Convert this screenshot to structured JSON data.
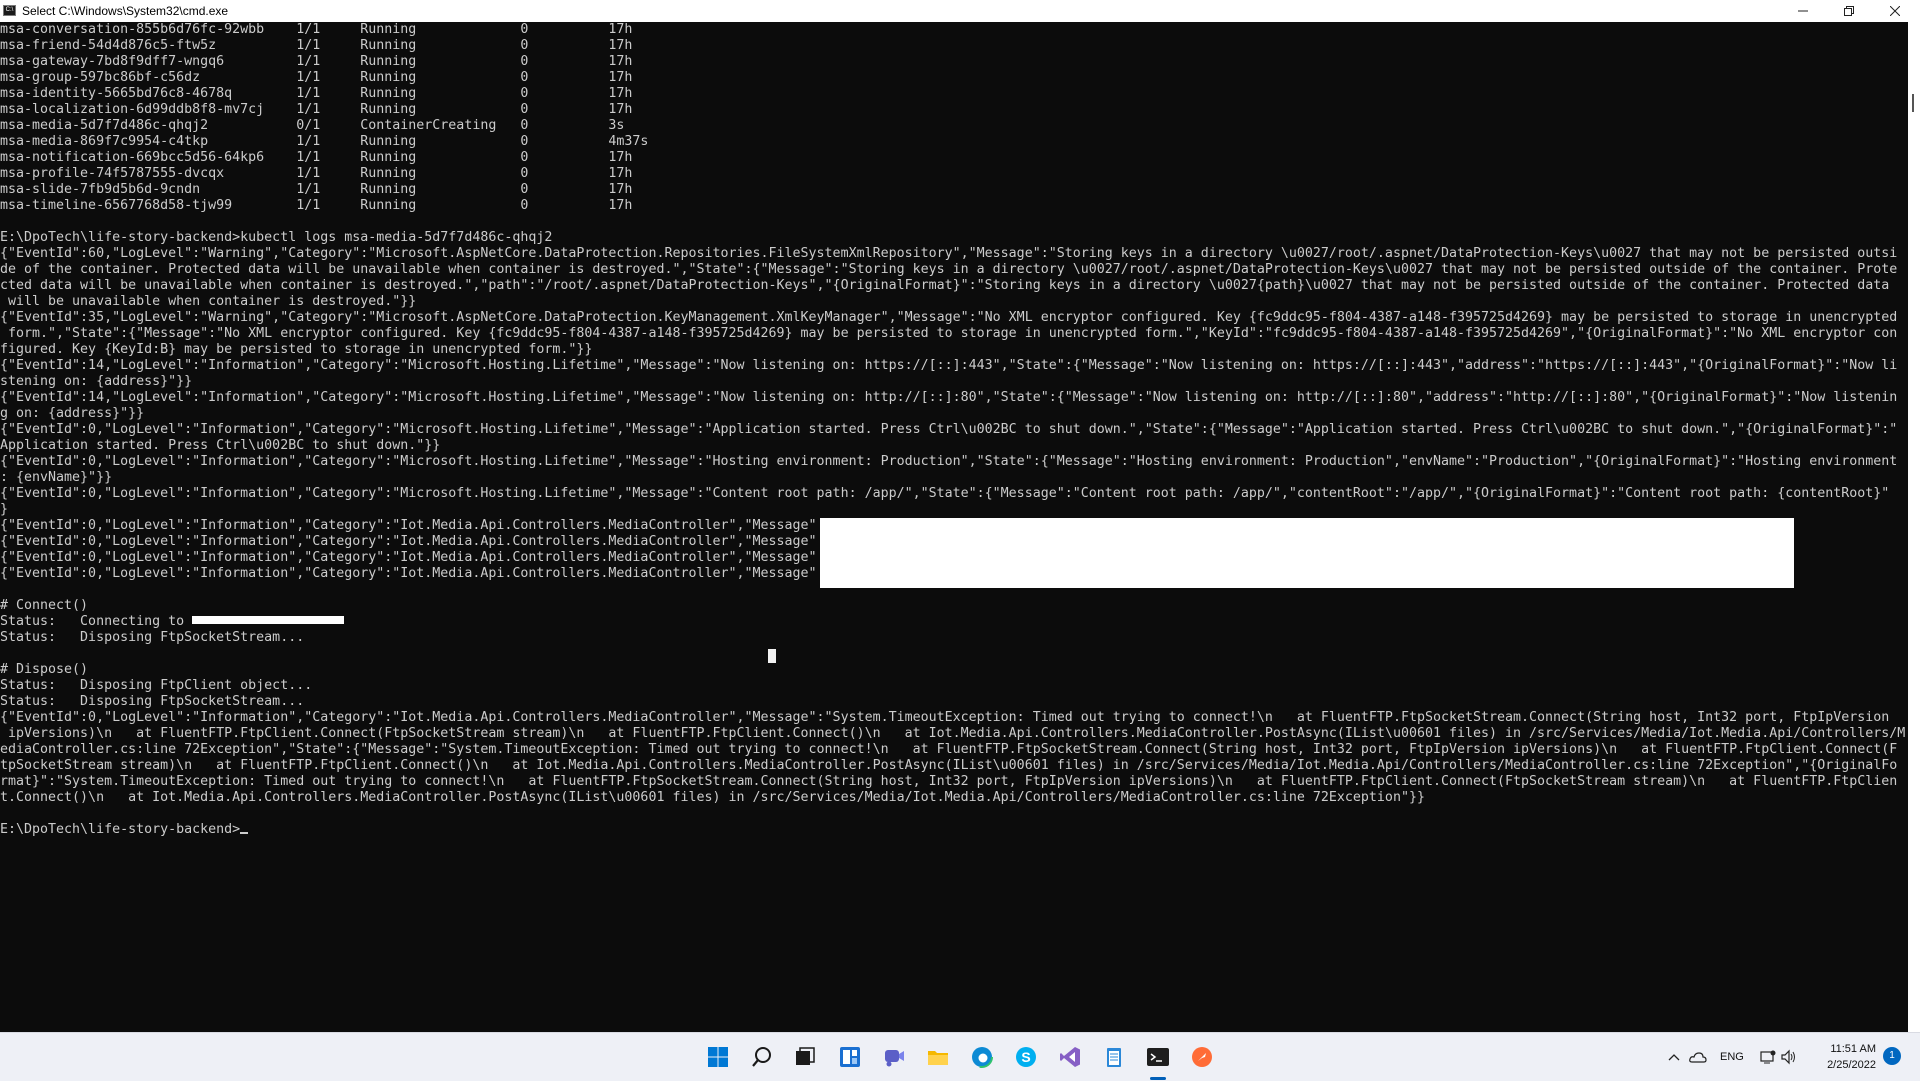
{
  "window": {
    "title": "Select C:\\Windows\\System32\\cmd.exe",
    "icon_label": "C:\\"
  },
  "console": {
    "lines": [
      "msa-conversation-855b6d76fc-92wbb    1/1     Running             0          17h",
      "msa-friend-54d4d876c5-ftw5z          1/1     Running             0          17h",
      "msa-gateway-7bd8f9dff7-wngq6         1/1     Running             0          17h",
      "msa-group-597bc86bf-c56dz            1/1     Running             0          17h",
      "msa-identity-5665bd76c8-4678q        1/1     Running             0          17h",
      "msa-localization-6d99ddb8f8-mv7cj    1/1     Running             0          17h",
      "msa-media-5d7f7d486c-qhqj2           0/1     ContainerCreating   0          3s",
      "msa-media-869f7c9954-c4tkp           1/1     Running             0          4m37s",
      "msa-notification-669bcc5d56-64kp6    1/1     Running             0          17h",
      "msa-profile-74f5787555-dvcqx         1/1     Running             0          17h",
      "msa-slide-7fb9d5b6d-9cndn            1/1     Running             0          17h",
      "msa-timeline-6567768d58-tjw99        1/1     Running             0          17h",
      "",
      "E:\\DpoTech\\life-story-backend>kubectl logs msa-media-5d7f7d486c-qhqj2",
      "{\"EventId\":60,\"LogLevel\":\"Warning\",\"Category\":\"Microsoft.AspNetCore.DataProtection.Repositories.FileSystemXmlRepository\",\"Message\":\"Storing keys in a directory \\u0027/root/.aspnet/DataProtection-Keys\\u0027 that may not be persisted outsi",
      "de of the container. Protected data will be unavailable when container is destroyed.\",\"State\":{\"Message\":\"Storing keys in a directory \\u0027/root/.aspnet/DataProtection-Keys\\u0027 that may not be persisted outside of the container. Prote",
      "cted data will be unavailable when container is destroyed.\",\"path\":\"/root/.aspnet/DataProtection-Keys\",\"{OriginalFormat}\":\"Storing keys in a directory \\u0027{path}\\u0027 that may not be persisted outside of the container. Protected data",
      " will be unavailable when container is destroyed.\"}}",
      "{\"EventId\":35,\"LogLevel\":\"Warning\",\"Category\":\"Microsoft.AspNetCore.DataProtection.KeyManagement.XmlKeyManager\",\"Message\":\"No XML encryptor configured. Key {fc9ddc95-f804-4387-a148-f395725d4269} may be persisted to storage in unencrypted",
      " form.\",\"State\":{\"Message\":\"No XML encryptor configured. Key {fc9ddc95-f804-4387-a148-f395725d4269} may be persisted to storage in unencrypted form.\",\"KeyId\":\"fc9ddc95-f804-4387-a148-f395725d4269\",\"{OriginalFormat}\":\"No XML encryptor con",
      "figured. Key {KeyId:B} may be persisted to storage in unencrypted form.\"}}",
      "{\"EventId\":14,\"LogLevel\":\"Information\",\"Category\":\"Microsoft.Hosting.Lifetime\",\"Message\":\"Now listening on: https://[::]:443\",\"State\":{\"Message\":\"Now listening on: https://[::]:443\",\"address\":\"https://[::]:443\",\"{OriginalFormat}\":\"Now li",
      "stening on: {address}\"}}",
      "{\"EventId\":14,\"LogLevel\":\"Information\",\"Category\":\"Microsoft.Hosting.Lifetime\",\"Message\":\"Now listening on: http://[::]:80\",\"State\":{\"Message\":\"Now listening on: http://[::]:80\",\"address\":\"http://[::]:80\",\"{OriginalFormat}\":\"Now listenin",
      "g on: {address}\"}}",
      "{\"EventId\":0,\"LogLevel\":\"Information\",\"Category\":\"Microsoft.Hosting.Lifetime\",\"Message\":\"Application started. Press Ctrl\\u002BC to shut down.\",\"State\":{\"Message\":\"Application started. Press Ctrl\\u002BC to shut down.\",\"{OriginalFormat}\":\"",
      "Application started. Press Ctrl\\u002BC to shut down.\"}}",
      "{\"EventId\":0,\"LogLevel\":\"Information\",\"Category\":\"Microsoft.Hosting.Lifetime\",\"Message\":\"Hosting environment: Production\",\"State\":{\"Message\":\"Hosting environment: Production\",\"envName\":\"Production\",\"{OriginalFormat}\":\"Hosting environment",
      ": {envName}\"}}",
      "{\"EventId\":0,\"LogLevel\":\"Information\",\"Category\":\"Microsoft.Hosting.Lifetime\",\"Message\":\"Content root path: /app/\",\"State\":{\"Message\":\"Content root path: /app/\",\"contentRoot\":\"/app/\",\"{OriginalFormat}\":\"Content root path: {contentRoot}\"",
      "}",
      "{\"EventId\":0,\"LogLevel\":\"Information\",\"Category\":\"Iot.Media.Api.Controllers.MediaController\",\"Message\"",
      "{\"EventId\":0,\"LogLevel\":\"Information\",\"Category\":\"Iot.Media.Api.Controllers.MediaController\",\"Message\"",
      "{\"EventId\":0,\"LogLevel\":\"Information\",\"Category\":\"Iot.Media.Api.Controllers.MediaController\",\"Message\"",
      "{\"EventId\":0,\"LogLevel\":\"Information\",\"Category\":\"Iot.Media.Api.Controllers.MediaController\",\"Message\"",
      "",
      "# Connect()",
      "Status:   Connecting to ",
      "Status:   Disposing FtpSocketStream...",
      "",
      "# Dispose()",
      "Status:   Disposing FtpClient object...",
      "Status:   Disposing FtpSocketStream...",
      "{\"EventId\":0,\"LogLevel\":\"Information\",\"Category\":\"Iot.Media.Api.Controllers.MediaController\",\"Message\":\"System.TimeoutException: Timed out trying to connect!\\n   at FluentFTP.FtpSocketStream.Connect(String host, Int32 port, FtpIpVersion",
      " ipVersions)\\n   at FluentFTP.FtpClient.Connect(FtpSocketStream stream)\\n   at FluentFTP.FtpClient.Connect()\\n   at Iot.Media.Api.Controllers.MediaController.PostAsync(IList\\u00601 files) in /src/Services/Media/Iot.Media.Api/Controllers/M",
      "ediaController.cs:line 72Exception\",\"State\":{\"Message\":\"System.TimeoutException: Timed out trying to connect!\\n   at FluentFTP.FtpSocketStream.Connect(String host, Int32 port, FtpIpVersion ipVersions)\\n   at FluentFTP.FtpClient.Connect(F",
      "tpSocketStream stream)\\n   at FluentFTP.FtpClient.Connect()\\n   at Iot.Media.Api.Controllers.MediaController.PostAsync(IList\\u00601 files) in /src/Services/Media/Iot.Media.Api/Controllers/MediaController.cs:line 72Exception\",\"{OriginalFo",
      "rmat}\":\"System.TimeoutException: Timed out trying to connect!\\n   at FluentFTP.FtpSocketStream.Connect(String host, Int32 port, FtpIpVersion ipVersions)\\n   at FluentFTP.FtpClient.Connect(FtpSocketStream stream)\\n   at FluentFTP.FtpClien",
      "t.Connect()\\n   at Iot.Media.Api.Controllers.MediaController.PostAsync(IList\\u00601 files) in /src/Services/Media/Iot.Media.Api/Controllers/MediaController.cs:line 72Exception\"}}",
      "",
      "E:\\DpoTech\\life-story-backend>"
    ]
  },
  "taskbar": {
    "apps": [
      {
        "name": "start-icon"
      },
      {
        "name": "search-icon"
      },
      {
        "name": "task-view-icon"
      },
      {
        "name": "widgets-icon"
      },
      {
        "name": "chat-icon"
      },
      {
        "name": "file-explorer-icon"
      },
      {
        "name": "edge-icon"
      },
      {
        "name": "skype-icon"
      },
      {
        "name": "visual-studio-icon"
      },
      {
        "name": "notepad-icon"
      },
      {
        "name": "terminal-icon"
      },
      {
        "name": "postman-icon"
      }
    ],
    "tray": {
      "language": "ENG",
      "time": "11:51 AM",
      "date": "2/25/2022",
      "notification_count": "1"
    }
  }
}
